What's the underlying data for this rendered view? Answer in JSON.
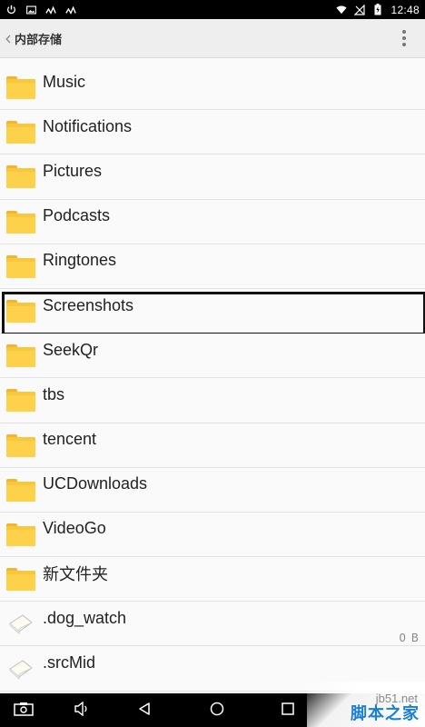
{
  "status_bar": {
    "time": "12:48",
    "left_icons": [
      "power-icon",
      "image-icon",
      "signal-icon",
      "signal-icon"
    ],
    "right_icons": [
      "wifi-icon",
      "no-sim-icon",
      "battery-icon"
    ]
  },
  "appbar": {
    "title": "内部存储",
    "back_icon": "chevron-left-icon",
    "menu_icon": "more-vert-icon"
  },
  "list": {
    "items": [
      {
        "name": "Music",
        "type": "folder"
      },
      {
        "name": "Notifications",
        "type": "folder"
      },
      {
        "name": "Pictures",
        "type": "folder"
      },
      {
        "name": "Podcasts",
        "type": "folder"
      },
      {
        "name": "Ringtones",
        "type": "folder"
      },
      {
        "name": "Screenshots",
        "type": "folder",
        "highlighted": true
      },
      {
        "name": "SeekQr",
        "type": "folder"
      },
      {
        "name": "tbs",
        "type": "folder"
      },
      {
        "name": "tencent",
        "type": "folder"
      },
      {
        "name": "UCDownloads",
        "type": "folder"
      },
      {
        "name": "VideoGo",
        "type": "folder"
      },
      {
        "name": "新文件夹",
        "type": "folder"
      },
      {
        "name": ".dog_watch",
        "type": "file",
        "size": "0 B"
      },
      {
        "name": ".srcMid",
        "type": "file"
      }
    ]
  },
  "navbar": {
    "icons": [
      "screenshot-icon",
      "volume-icon",
      "back-icon",
      "home-icon",
      "recents-icon"
    ]
  },
  "watermark": {
    "url": "jb51.net",
    "text": "脚本之家"
  },
  "colors": {
    "folder": "#f9c73a",
    "status_bar": "#000000",
    "appbar": "#eeeeee",
    "watermark_blue": "#1a7fd6"
  }
}
